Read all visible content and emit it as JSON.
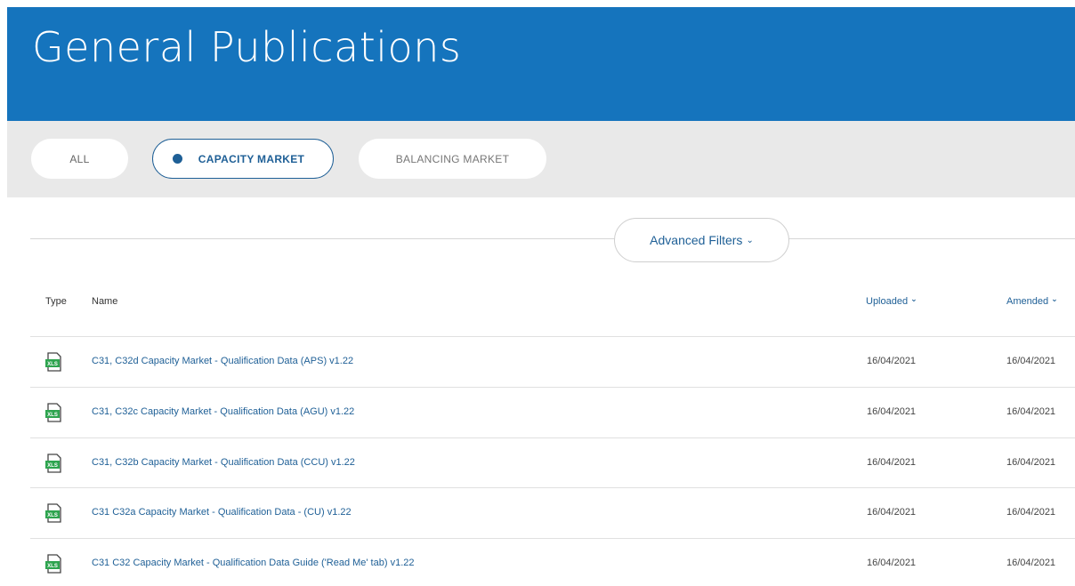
{
  "header": {
    "title": "General Publications"
  },
  "tabs": [
    {
      "label": "ALL"
    },
    {
      "label": "CAPACITY MARKET"
    },
    {
      "label": "BALANCING MARKET"
    }
  ],
  "filters": {
    "label": "Advanced Filters",
    "chevron": "⌄"
  },
  "table": {
    "headers": {
      "type": "Type",
      "name": "Name",
      "uploaded": "Uploaded",
      "amended": "Amended"
    },
    "rows": [
      {
        "icon": "xls-file-icon",
        "icon_text": "XLS",
        "name": "C31, C32d Capacity Market - Qualification Data (APS) v1.22",
        "uploaded": "16/04/2021",
        "amended": "16/04/2021"
      },
      {
        "icon": "xls-file-icon",
        "icon_text": "XLS",
        "name": "C31, C32c Capacity Market - Qualification Data (AGU) v1.22",
        "uploaded": "16/04/2021",
        "amended": "16/04/2021"
      },
      {
        "icon": "xls-file-icon",
        "icon_text": "XLS",
        "name": "C31, C32b Capacity Market - Qualification Data (CCU) v1.22",
        "uploaded": "16/04/2021",
        "amended": "16/04/2021"
      },
      {
        "icon": "xls-file-icon",
        "icon_text": "XLS",
        "name": "C31 C32a Capacity Market - Qualification Data - (CU) v1.22",
        "uploaded": "16/04/2021",
        "amended": "16/04/2021"
      },
      {
        "icon": "xls-file-icon",
        "icon_text": "XLS",
        "name": "C31 C32 Capacity Market - Qualification Data Guide ('Read Me' tab) v1.22",
        "uploaded": "16/04/2021",
        "amended": "16/04/2021"
      }
    ]
  },
  "colors": {
    "brand_blue": "#1574bd",
    "link_blue": "#1e5f96",
    "xls_green": "#2ea44f"
  }
}
